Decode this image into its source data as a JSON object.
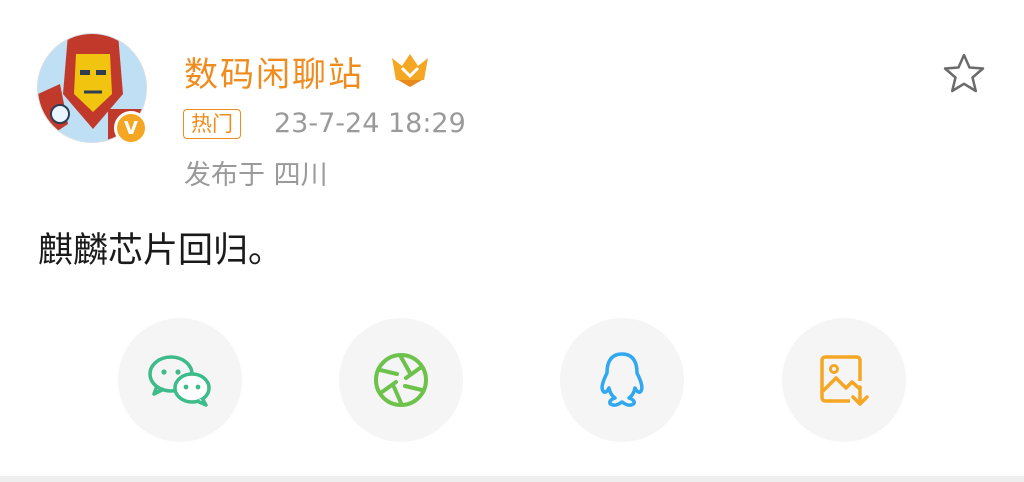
{
  "post": {
    "username": "数码闲聊站",
    "hot_tag": "热门",
    "time": "23-7-24 18:29",
    "location": "发布于 四川",
    "content": "麒麟芯片回归。",
    "verified_badge": "V"
  },
  "share_targets": [
    {
      "icon": "wechat-icon",
      "color": "#3dbb8a"
    },
    {
      "icon": "moments-icon",
      "color": "#6cc24a"
    },
    {
      "icon": "qq-icon",
      "color": "#2fa8f0"
    },
    {
      "icon": "save-image-icon",
      "color": "#f5a623"
    }
  ],
  "colors": {
    "accent": "#f08c1e",
    "muted_text": "#9a9a9a",
    "body_text": "#1a1a1a"
  }
}
